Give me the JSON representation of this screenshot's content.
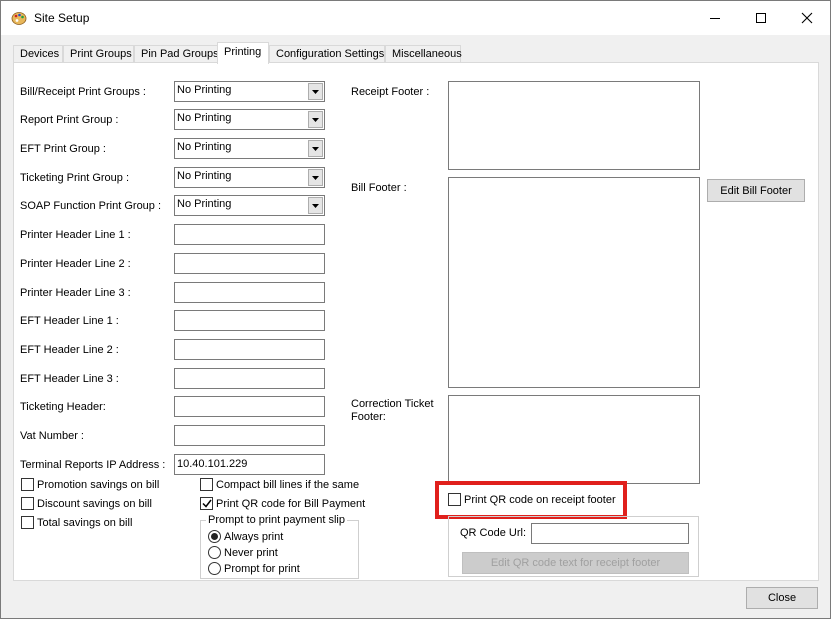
{
  "window": {
    "title": "Site Setup",
    "colors": {
      "highlight": "#e0201c",
      "window_bg": "#f0f0f0",
      "panel_bg": "#ffffff"
    }
  },
  "tabs": [
    {
      "label": "Devices"
    },
    {
      "label": "Print Groups"
    },
    {
      "label": "Pin Pad Groups"
    },
    {
      "label": "Printing",
      "active": true
    },
    {
      "label": "Configuration Settings"
    },
    {
      "label": "Miscellaneous"
    }
  ],
  "form": {
    "bill_receipt_print_groups": {
      "label": "Bill/Receipt Print Groups :",
      "value": "No Printing"
    },
    "report_print_group": {
      "label": "Report Print Group :",
      "value": "No Printing"
    },
    "eft_print_group": {
      "label": "EFT Print Group :",
      "value": "No Printing"
    },
    "ticketing_print_group": {
      "label": "Ticketing Print Group :",
      "value": "No Printing"
    },
    "soap_function_print_group": {
      "label": "SOAP Function Print Group :",
      "value": "No Printing"
    },
    "printer_header_line_1": {
      "label": "Printer Header Line 1 :",
      "value": ""
    },
    "printer_header_line_2": {
      "label": "Printer Header Line 2 :",
      "value": ""
    },
    "printer_header_line_3": {
      "label": "Printer Header Line 3 :",
      "value": ""
    },
    "eft_header_line_1": {
      "label": "EFT Header Line 1 :",
      "value": ""
    },
    "eft_header_line_2": {
      "label": "EFT Header Line 2 :",
      "value": ""
    },
    "eft_header_line_3": {
      "label": "EFT Header Line 3 :",
      "value": ""
    },
    "ticketing_header": {
      "label": "Ticketing Header:",
      "value": ""
    },
    "vat_number": {
      "label": "Vat Number :",
      "value": ""
    },
    "terminal_reports_ip": {
      "label": "Terminal Reports IP Address :",
      "value": "10.40.101.229"
    }
  },
  "checkboxes": {
    "promotion_savings": {
      "label": "Promotion savings on bill",
      "checked": false
    },
    "discount_savings": {
      "label": "Discount savings on bill",
      "checked": false
    },
    "total_savings": {
      "label": "Total savings on bill",
      "checked": false
    },
    "compact_bill_lines": {
      "label": "Compact bill lines if the same",
      "checked": false
    },
    "print_qr_bill_payment": {
      "label": "Print QR code for Bill Payment",
      "checked": true
    },
    "print_qr_receipt_footer": {
      "label": "Print QR code on receipt footer",
      "checked": false
    }
  },
  "payment_slip": {
    "title": "Prompt to print payment slip",
    "options": [
      {
        "label": "Always print",
        "selected": true
      },
      {
        "label": "Never print",
        "selected": false
      },
      {
        "label": "Prompt for print",
        "selected": false
      }
    ]
  },
  "footers": {
    "receipt_footer_label": "Receipt Footer :",
    "bill_footer_label": "Bill Footer :",
    "correction_ticket_footer_label_line1": "Correction Ticket",
    "correction_ticket_footer_label_line2": "Footer:",
    "edit_bill_footer_button": "Edit Bill Footer"
  },
  "qr": {
    "url_label": "QR Code Url:",
    "url_value": "",
    "edit_button": "Edit QR code text for receipt footer"
  },
  "close_button": "Close",
  "icons": {
    "app": "palette-icon",
    "dropdown": "chevron-down-icon",
    "minimize": "minimize-icon",
    "maximize": "maximize-icon",
    "close": "close-icon",
    "check": "checkmark-icon"
  }
}
